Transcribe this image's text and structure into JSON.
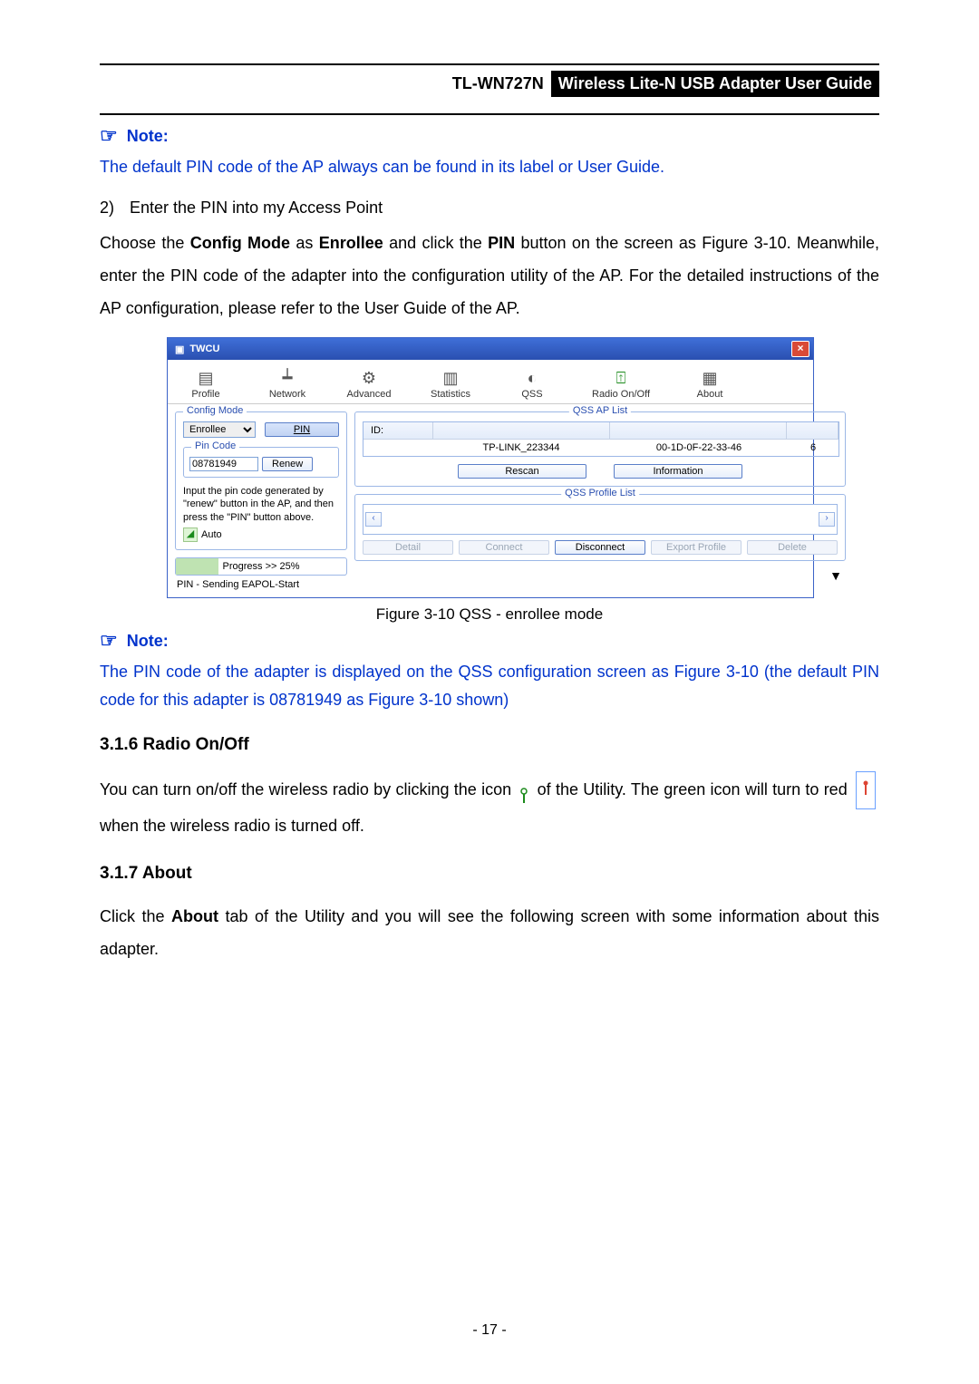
{
  "header": {
    "model": "TL-WN727N",
    "title": "Wireless Lite-N USB Adapter User Guide"
  },
  "notes": {
    "label": "Note:",
    "note1": "The default PIN code of the AP always can be found in its label or User Guide.",
    "note2a": "The PIN code of the adapter is displayed on the QSS configuration screen as Figure 3-10 (the default PIN code for this adapter is 08781949 as Figure 3-10 shown)"
  },
  "step2": {
    "num": "2)",
    "text": "Enter the PIN into my Access Point"
  },
  "para_choose": {
    "p1a": "Choose the ",
    "p1b": "Config Mode",
    "p1c": " as ",
    "p1d": "Enrollee",
    "p1e": " and click the ",
    "p1f": "PIN",
    "p1g": " button on the screen as Figure 3-10. Meanwhile, enter the PIN code of the adapter into the configuration utility of the AP. For the detailed instructions of the AP configuration, please refer to the User Guide of the AP."
  },
  "figure_caption": "Figure 3-10 QSS - enrollee mode",
  "sections": {
    "radio_title": "3.1.6 Radio On/Off",
    "radio_p1a": "You can turn on/off the wireless radio by clicking the icon ",
    "radio_p1b": " of the Utility. The green icon will turn to red ",
    "radio_p1c": " when the wireless radio is turned off.",
    "about_title": "3.1.7 About",
    "about_p1a": "Click the ",
    "about_p1b": "About",
    "about_p1c": " tab of the Utility and you will see the following screen with some information about this adapter."
  },
  "page_number": "- 17 -",
  "twcu": {
    "title": "TWCU",
    "tabs": {
      "profile": "Profile",
      "network": "Network",
      "advanced": "Advanced",
      "statistics": "Statistics",
      "qss": "QSS",
      "radio": "Radio On/Off",
      "about": "About"
    },
    "config_mode": {
      "title": "Config Mode",
      "selected": "Enrollee",
      "pin_btn": "PIN"
    },
    "pin_code": {
      "title": "Pin Code",
      "value": "08781949",
      "renew_btn": "Renew"
    },
    "hint": "Input the pin code generated by \"renew\" button in the AP, and then press the \"PIN\" button above.",
    "auto": "Auto",
    "progress": {
      "label": "Progress >> 25%",
      "percent": 25
    },
    "status": "PIN - Sending EAPOL-Start",
    "ap_list": {
      "title": "QSS AP List",
      "head_id": "ID:",
      "row": {
        "ssid": "TP-LINK_223344",
        "bssid": "00-1D-0F-22-33-46",
        "ch": "6"
      },
      "rescan_btn": "Rescan",
      "info_btn": "Information"
    },
    "profile_list": {
      "title": "QSS Profile List"
    },
    "bottom_btns": {
      "detail": "Detail",
      "connect": "Connect",
      "disconnect": "Disconnect",
      "export": "Export Profile",
      "delete": "Delete"
    }
  }
}
